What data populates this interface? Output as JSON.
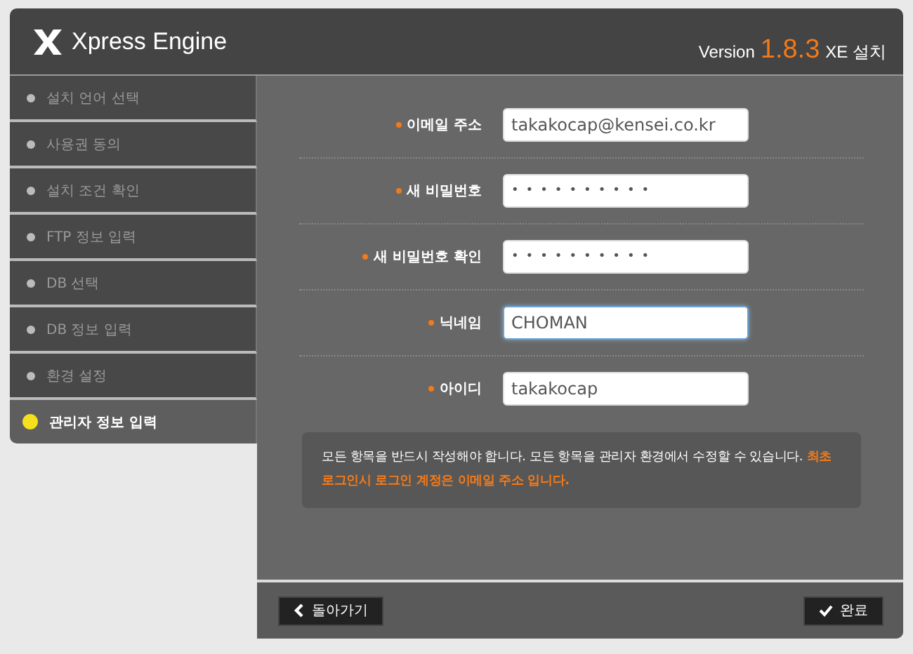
{
  "header": {
    "logo": "Xpress Engine",
    "version_label": "Version",
    "version": "1.8.3",
    "suffix": "XE 설치"
  },
  "steps": [
    {
      "label": "설치 언어 선택",
      "selected": false
    },
    {
      "label": "사용권 동의",
      "selected": false
    },
    {
      "label": "설치 조건 확인",
      "selected": false
    },
    {
      "label": "FTP 정보 입력",
      "selected": false
    },
    {
      "label": "DB 선택",
      "selected": false
    },
    {
      "label": "DB 정보 입력",
      "selected": false
    },
    {
      "label": "환경 설정",
      "selected": false
    },
    {
      "label": "관리자 정보 입력",
      "selected": true
    }
  ],
  "fields": [
    {
      "label": "이메일 주소",
      "value": "takakocap@kensei.co.kr",
      "kind": "text",
      "focused": false
    },
    {
      "label": "새 비밀번호",
      "value": "••••••••••",
      "kind": "password",
      "focused": false
    },
    {
      "label": "새 비밀번호 확인",
      "value": "••••••••••",
      "kind": "password",
      "focused": false
    },
    {
      "label": "닉네임",
      "value": "CHOMAN",
      "kind": "text",
      "focused": true
    },
    {
      "label": "아이디",
      "value": "takakocap",
      "kind": "text",
      "focused": false
    }
  ],
  "notice": "모든 항목을 반드시 작성해야 합니다. 모든 항목을 관리자 환경에서 수정할 수 있습니다. **최초 로그인시 로그인 계정은 이메일 주소 입니다.**",
  "buttons": {
    "back": "돌아가기",
    "done": "완료"
  }
}
